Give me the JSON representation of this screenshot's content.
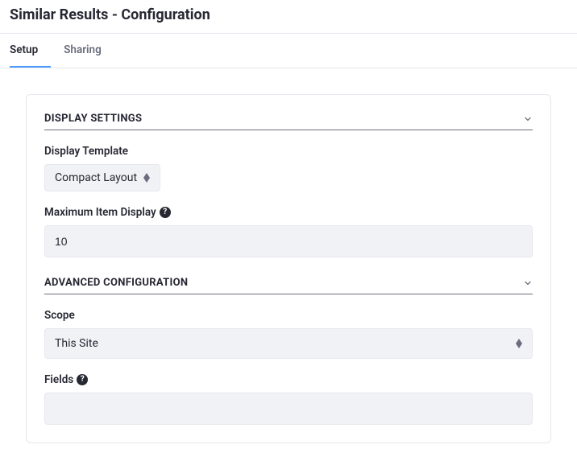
{
  "page_title": "Similar Results - Configuration",
  "tabs": {
    "setup": "Setup",
    "sharing": "Sharing"
  },
  "sections": {
    "display_settings": {
      "title": "DISPLAY SETTINGS",
      "display_template_label": "Display Template",
      "display_template_value": "Compact Layout",
      "max_item_label": "Maximum Item Display",
      "max_item_value": "10"
    },
    "advanced": {
      "title": "ADVANCED CONFIGURATION",
      "scope_label": "Scope",
      "scope_value": "This Site",
      "fields_label": "Fields",
      "fields_value": ""
    }
  }
}
